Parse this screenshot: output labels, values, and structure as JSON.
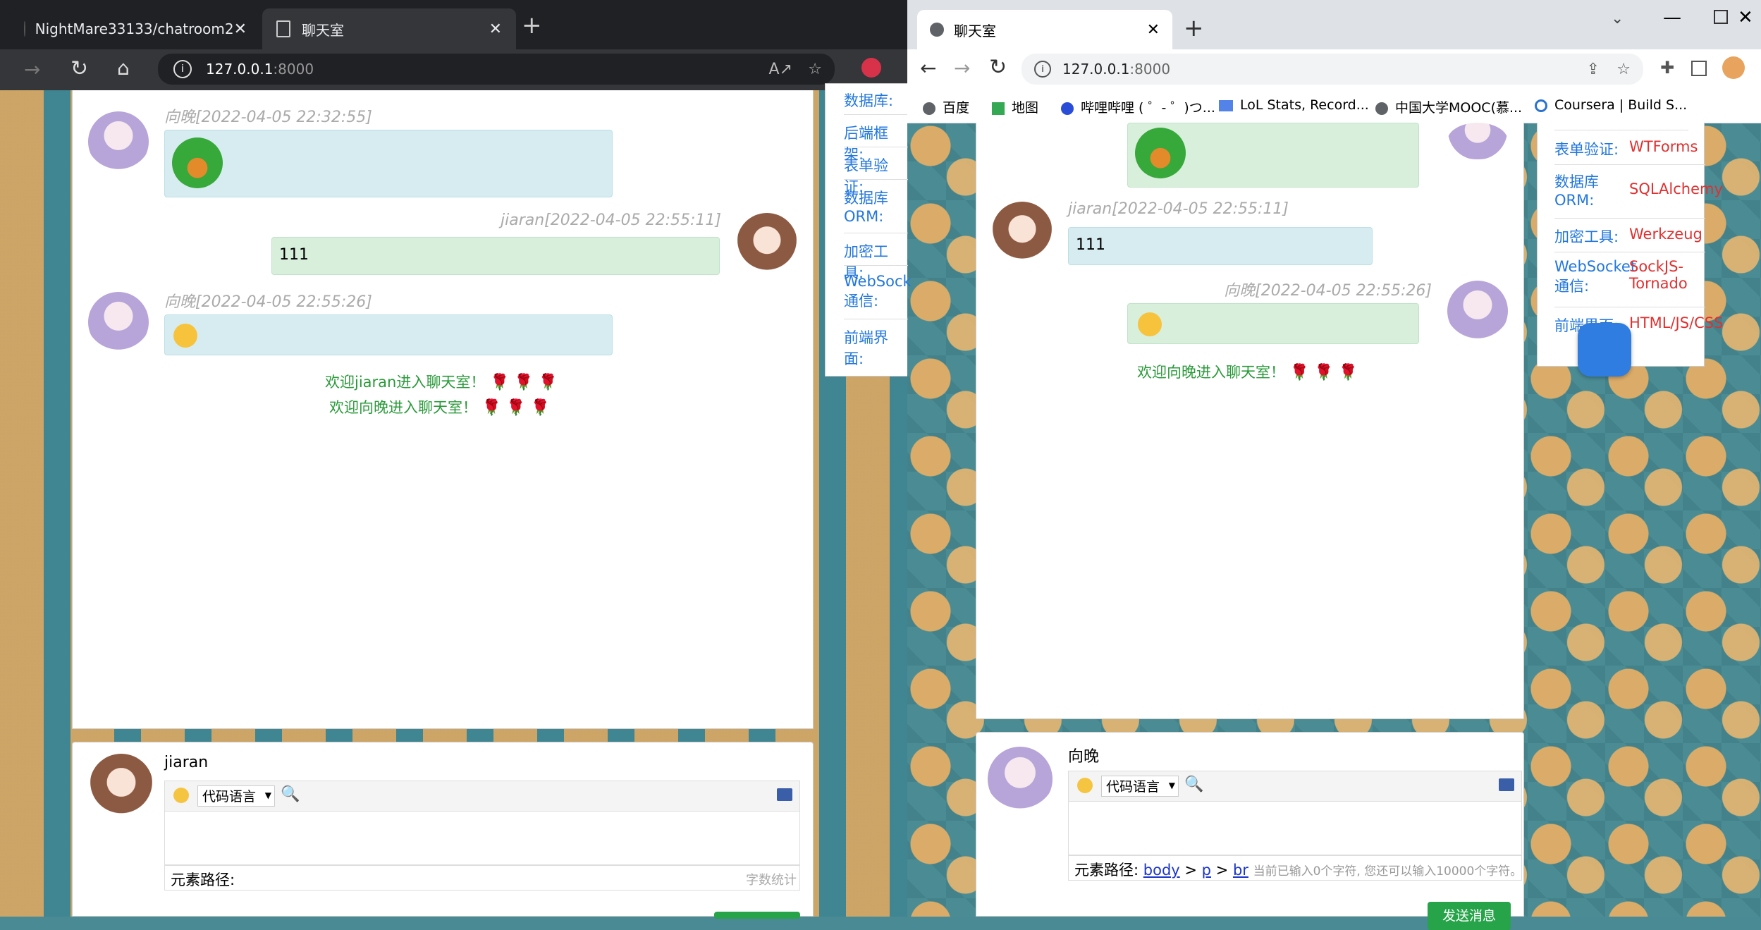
{
  "left_browser": {
    "tabs": [
      {
        "title": "NightMare33133/chatroom2"
      },
      {
        "title": "聊天室"
      }
    ],
    "url": "127.0.0.1",
    "url_port": ":8000"
  },
  "right_browser": {
    "tab_title": "聊天室",
    "url": "127.0.0.1",
    "url_port": ":8000",
    "bookmarks": [
      "百度",
      "地图",
      "哔哩哔哩 ( ゜- ゜)つ...",
      "LoL Stats, Record...",
      "中国大学MOOC(慕...",
      "Coursera | Build S..."
    ]
  },
  "left_chat": {
    "messages": [
      {
        "time": "向晚[2022-04-05 22:32:55]"
      },
      {
        "time": "jiaran[2022-04-05 22:55:11]",
        "text": "111"
      },
      {
        "time": "向晚[2022-04-05 22:55:26]"
      }
    ],
    "welcome": [
      "欢迎jiaran进入聊天室！",
      "欢迎向晚进入聊天室！"
    ],
    "input": {
      "username": "jiaran",
      "code_lang": "代码语言",
      "path_label": "元素路径:",
      "count_label": "字数统计"
    },
    "sidebar": [
      "数据库:",
      "后端框架:",
      "表单验证:",
      "数据库 ORM:",
      "加密工具:",
      "WebSock 通信:",
      "前端界面:"
    ]
  },
  "right_chat": {
    "messages": [
      {
        "time": "jiaran[2022-04-05 22:55:11]",
        "text": "111"
      },
      {
        "time": "向晚[2022-04-05 22:55:26]"
      }
    ],
    "welcome": "欢迎向晚进入聊天室！",
    "input": {
      "username": "向晚",
      "code_lang": "代码语言",
      "path_label": "元素路径:",
      "path_body": "body",
      "path_p": "p",
      "path_br": "br",
      "count_text": "当前已输入0个字符, 您还可以输入10000个字符。",
      "send_label": "发送消息"
    },
    "sidebar": [
      {
        "label": "表单验证:",
        "value": "WTForms"
      },
      {
        "label": "数据库 ORM:",
        "value": "SQLAlchemy"
      },
      {
        "label": "加密工具:",
        "value": "Werkzeug"
      },
      {
        "label": "WebSocket 通信:",
        "value": "SockJS-Tornado"
      },
      {
        "label": "前端界面:",
        "value": "HTML/JS/CSS"
      }
    ]
  },
  "colors": {
    "welcome": "#2a9a3a",
    "link": "#2277dd",
    "value": "#e03030",
    "send": "#27a34a"
  }
}
